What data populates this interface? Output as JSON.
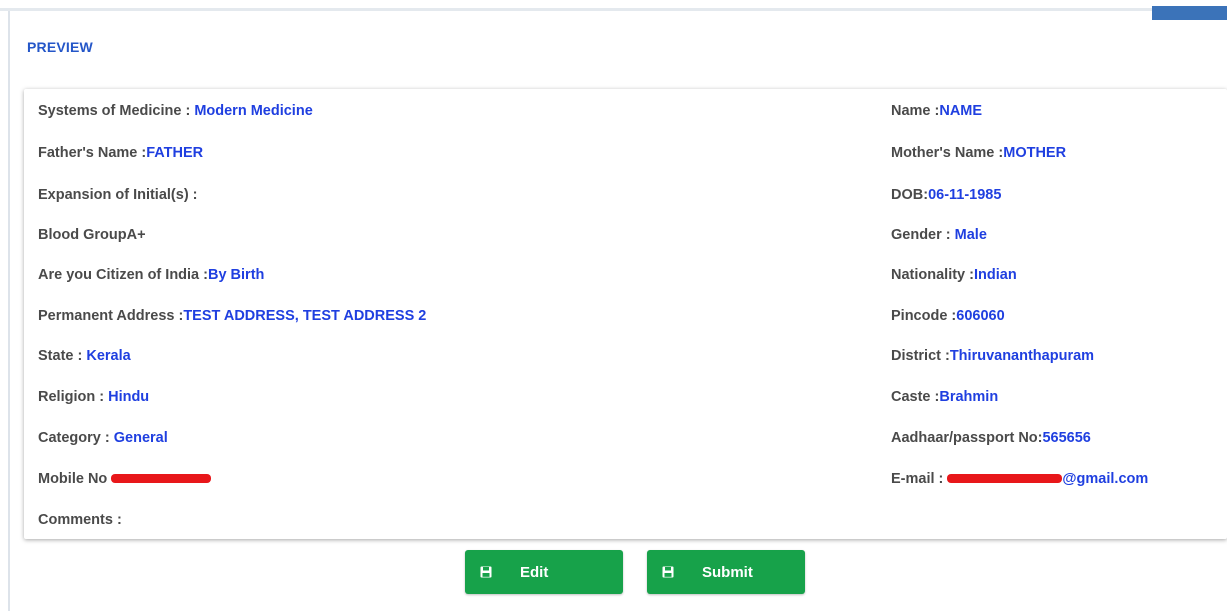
{
  "page": {
    "section_title": "PREVIEW"
  },
  "fields": {
    "systems_label": "Systems of Medicine : ",
    "systems_value": "Modern Medicine",
    "name_label": "Name :",
    "name_value": "NAME",
    "father_label": "Father's Name :",
    "father_value": "FATHER",
    "mother_label": "Mother's Name :",
    "mother_value": "MOTHER",
    "initials_label": "Expansion of Initial(s) :",
    "dob_label": "DOB:",
    "dob_value": "06-11-1985",
    "blood_label": "Blood GroupA+",
    "gender_label": "Gender : ",
    "gender_value": "Male",
    "citizen_label": "Are you Citizen of India :",
    "citizen_value": "By Birth",
    "nationality_label": "Nationality :",
    "nationality_value": "Indian",
    "address_label": "Permanent Address :",
    "address_value": "TEST ADDRESS, TEST ADDRESS 2",
    "pincode_label": "Pincode :",
    "pincode_value": "606060",
    "state_label": "State : ",
    "state_value": "Kerala",
    "district_label": "District :",
    "district_value": "Thiruvananthapuram",
    "religion_label": "Religion : ",
    "religion_value": "Hindu",
    "caste_label": "Caste :",
    "caste_value": "Brahmin",
    "category_label": "Category : ",
    "category_value": "General",
    "aadhaar_label": "Aadhaar/passport No:",
    "aadhaar_value": "565656",
    "mobile_label": "Mobile No ",
    "email_label": "E-mail : ",
    "email_value": "@gmail.com",
    "comments_label": "Comments :"
  },
  "buttons": {
    "edit_label": "Edit",
    "submit_label": "Submit"
  },
  "icons": {
    "edit_icon": "floppy-disk-icon",
    "submit_icon": "floppy-disk-icon"
  },
  "colors": {
    "accent": "#2456c8",
    "value_text": "#1f3fe0",
    "button_green": "#17a24a",
    "redaction": "#e8171a"
  }
}
